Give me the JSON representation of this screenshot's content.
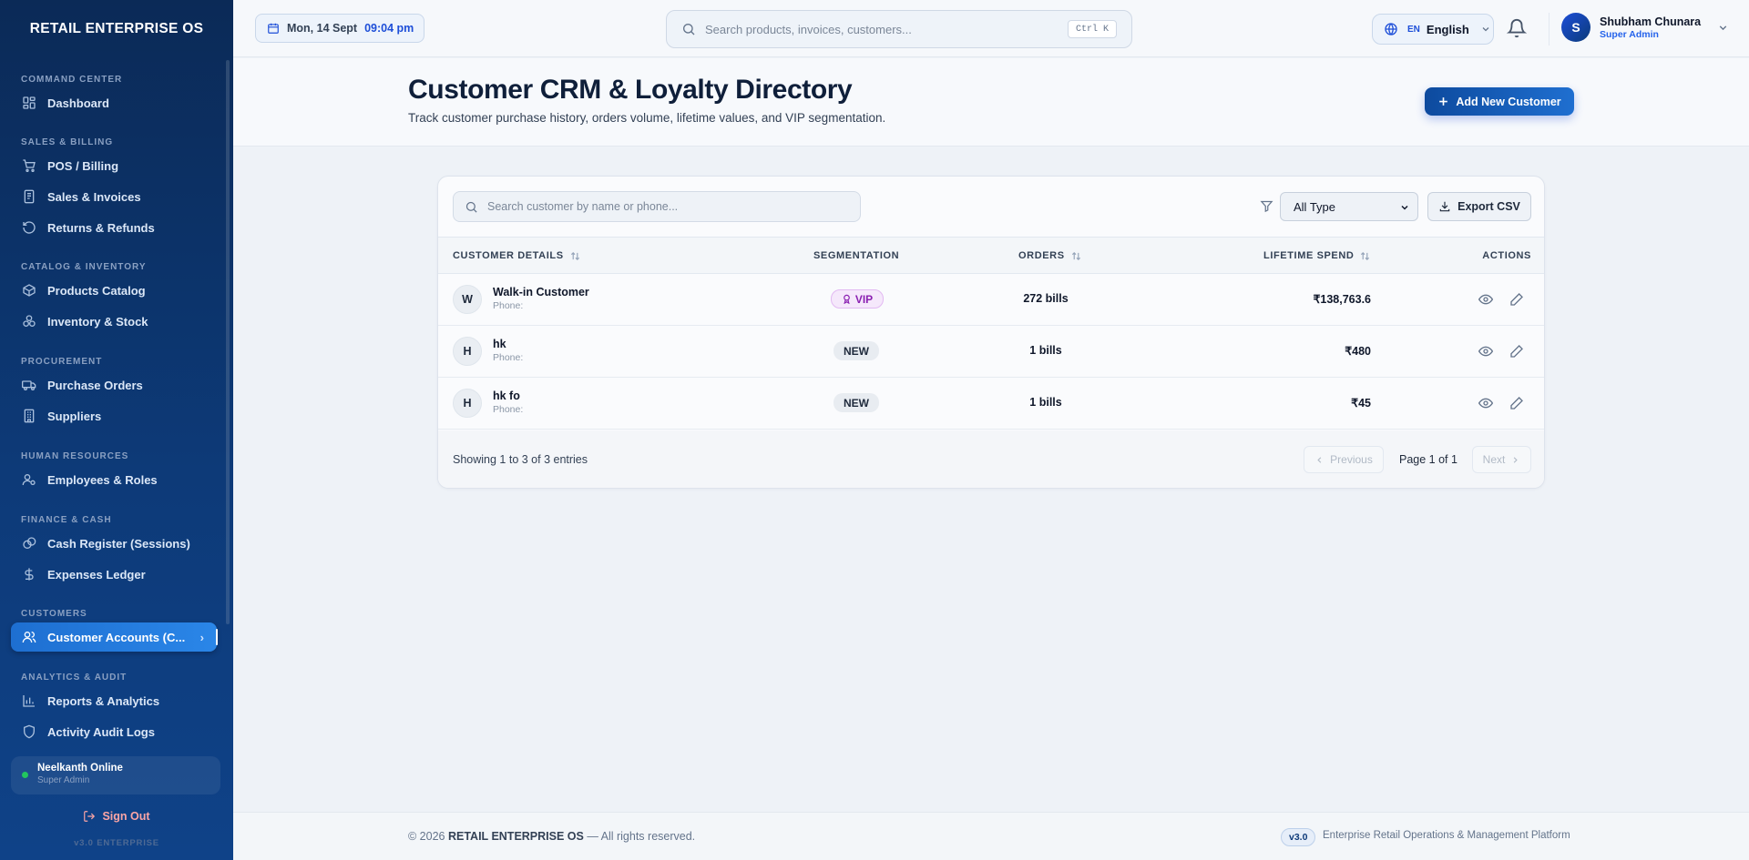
{
  "app": {
    "brand": "RETAIL ENTERPRISE OS"
  },
  "sidebar": {
    "sections": [
      {
        "title": "COMMAND CENTER",
        "items": [
          {
            "label": "Dashboard",
            "icon": "dashboard-icon"
          }
        ]
      },
      {
        "title": "SALES & BILLING",
        "items": [
          {
            "label": "POS / Billing",
            "icon": "cart-icon"
          },
          {
            "label": "Sales & Invoices",
            "icon": "invoice-icon"
          },
          {
            "label": "Returns & Refunds",
            "icon": "refund-icon"
          }
        ]
      },
      {
        "title": "CATALOG & INVENTORY",
        "items": [
          {
            "label": "Products Catalog",
            "icon": "box-icon"
          },
          {
            "label": "Inventory & Stock",
            "icon": "stock-icon"
          }
        ]
      },
      {
        "title": "PROCUREMENT",
        "items": [
          {
            "label": "Purchase Orders",
            "icon": "truck-icon"
          },
          {
            "label": "Suppliers",
            "icon": "building-icon"
          }
        ]
      },
      {
        "title": "HUMAN RESOURCES",
        "items": [
          {
            "label": "Employees & Roles",
            "icon": "user-cog-icon"
          }
        ]
      },
      {
        "title": "FINANCE & CASH",
        "items": [
          {
            "label": "Cash Register (Sessions)",
            "icon": "coins-icon"
          },
          {
            "label": "Expenses Ledger",
            "icon": "dollar-icon"
          }
        ]
      },
      {
        "title": "CUSTOMERS",
        "items": [
          {
            "label": "Customer Accounts (C...",
            "icon": "users-icon",
            "active": true
          }
        ]
      },
      {
        "title": "ANALYTICS & AUDIT",
        "items": [
          {
            "label": "Reports & Analytics",
            "icon": "chart-icon"
          },
          {
            "label": "Activity Audit Logs",
            "icon": "shield-icon"
          }
        ]
      }
    ],
    "status": {
      "name": "Neelkanth Online",
      "role": "Super Admin",
      "color": "#22c55e"
    },
    "signout": "Sign Out",
    "version": "v3.0 ENTERPRISE"
  },
  "topbar": {
    "date": "Mon, 14 Sept",
    "time": "09:04 pm",
    "search_placeholder": "Search products, invoices, customers...",
    "shortcut": "Ctrl K",
    "lang_code": "EN",
    "lang_name": "English",
    "user": {
      "initial": "S",
      "name": "Shubham Chunara",
      "role": "Super Admin"
    }
  },
  "header": {
    "title": "Customer CRM & Loyalty Directory",
    "subtitle": "Track customer purchase history, orders volume, lifetime values, and VIP segmentation.",
    "add_button": "Add New Customer"
  },
  "table": {
    "search_placeholder": "Search customer by name or phone...",
    "type_filter": "All Type",
    "export_label": "Export CSV",
    "columns": {
      "details": "CUSTOMER DETAILS",
      "segmentation": "SEGMENTATION",
      "orders": "ORDERS",
      "spend": "LIFETIME SPEND",
      "actions": "ACTIONS"
    },
    "rows": [
      {
        "initial": "W",
        "name": "Walk-in Customer",
        "phone": "Phone:",
        "segment": "VIP",
        "orders": "272 bills",
        "spend": "₹138,763.6"
      },
      {
        "initial": "H",
        "name": "hk",
        "phone": "Phone:",
        "segment": "NEW",
        "orders": "1 bills",
        "spend": "₹480"
      },
      {
        "initial": "H",
        "name": "hk fo",
        "phone": "Phone:",
        "segment": "NEW",
        "orders": "1 bills",
        "spend": "₹45"
      }
    ],
    "showing": "Showing 1 to 3 of 3 entries",
    "prev": "Previous",
    "page": "Page 1 of 1",
    "next": "Next"
  },
  "footer": {
    "copyright_prefix": "© 2026",
    "brand": "RETAIL ENTERPRISE OS",
    "copyright_suffix": "— All rights reserved.",
    "version": "v3.0",
    "platform": "Enterprise Retail Operations & Management Platform"
  },
  "colors": {
    "accent": "#1d6fd1",
    "vip": "#8a1fb1",
    "online": "#22c55e",
    "sidebar": "#0b2a57"
  }
}
